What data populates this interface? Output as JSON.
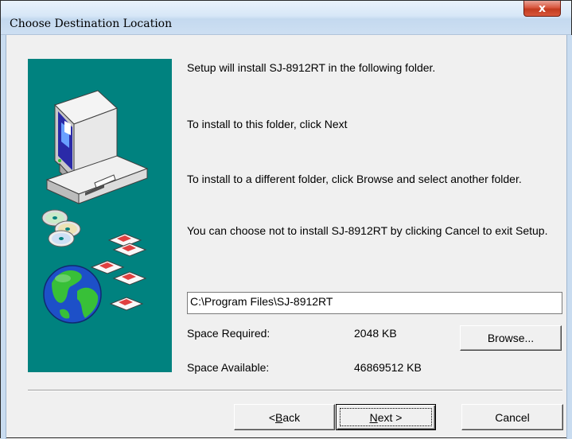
{
  "window": {
    "title": "Choose Destination Location",
    "close_glyph": "x"
  },
  "body": {
    "line1": "Setup will install SJ-8912RT in the following folder.",
    "line2": "To install to this folder, click Next",
    "line3": "To install to a different folder, click Browse and select another folder.",
    "line4": "You can choose not to install SJ-8912RT by clicking Cancel to exit Setup."
  },
  "destination": {
    "path": "C:\\Program Files\\SJ-8912RT"
  },
  "space": {
    "required_label": "Space Required:",
    "required_value": "2048 KB",
    "available_label": "Space Available:",
    "available_value": "46869512 KB"
  },
  "buttons": {
    "browse": "Browse...",
    "back_prefix": "< ",
    "back_hotkey": "B",
    "back_rest": "ack",
    "next_hotkey": "N",
    "next_rest": "ext >",
    "cancel": "Cancel"
  },
  "art": {
    "panel_color": "#00827f",
    "icons": [
      "computer-icon",
      "cd-discs-icon",
      "floppy-disks-icon",
      "globe-icon"
    ]
  }
}
